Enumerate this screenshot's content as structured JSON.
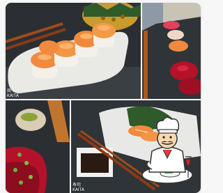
{
  "gallery": {
    "photos": [
      {
        "caption_top": "阁",
        "caption_bottom": "KAITA",
        "alt": "Salmon aburi sushi rolls on a white plate"
      },
      {
        "caption_top": "",
        "caption_bottom": "",
        "alt": "Tuna and salmon sashimi on a slate board"
      },
      {
        "caption_top": "",
        "caption_bottom": "",
        "alt": "Seared tuna tataki with scallions"
      },
      {
        "caption_top": "寿司",
        "caption_bottom": "KAITA",
        "alt": "Salmon sashimi with soy sauce and chopsticks"
      }
    ]
  },
  "badge": {
    "icon": "chef-icon",
    "alt": "Chef waiter illustration holding a dish"
  },
  "colors": {
    "salmon": "#f08a3e",
    "tuna": "#b3122a",
    "slate": "#2c3033",
    "wood": "#c0752f"
  }
}
